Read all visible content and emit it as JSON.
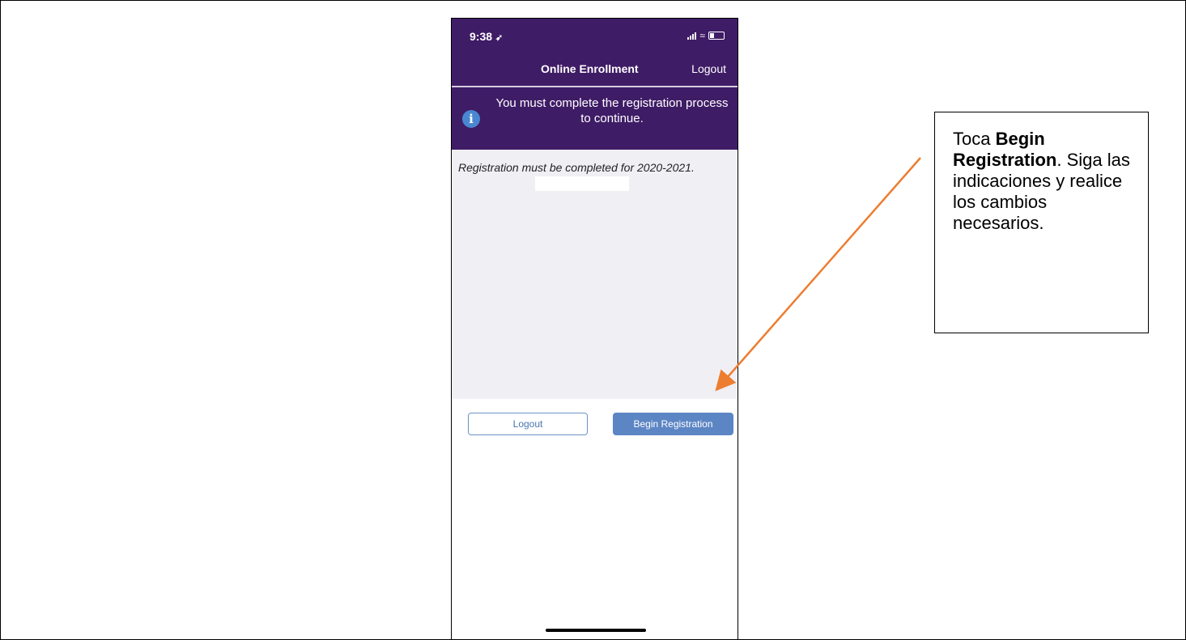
{
  "status_bar": {
    "time": "9:38",
    "location_glyph": "➶"
  },
  "nav": {
    "title": "Online Enrollment",
    "logout_label": "Logout"
  },
  "banner": {
    "icon": "info-icon",
    "message": "You must complete the registration process to continue."
  },
  "content": {
    "registration_notice": "Registration must be completed for 2020-2021."
  },
  "actions": {
    "logout_label": "Logout",
    "begin_label": "Begin Registration"
  },
  "callout": {
    "prefix": "Toca ",
    "bold": "Begin Registration",
    "suffix": ". Siga las indicaciones y realice los cambios necesarios."
  },
  "colors": {
    "header": "#3f1c66",
    "primary_button": "#5c85c4",
    "arrow": "#ed7d31",
    "info_icon": "#4a87d2"
  }
}
